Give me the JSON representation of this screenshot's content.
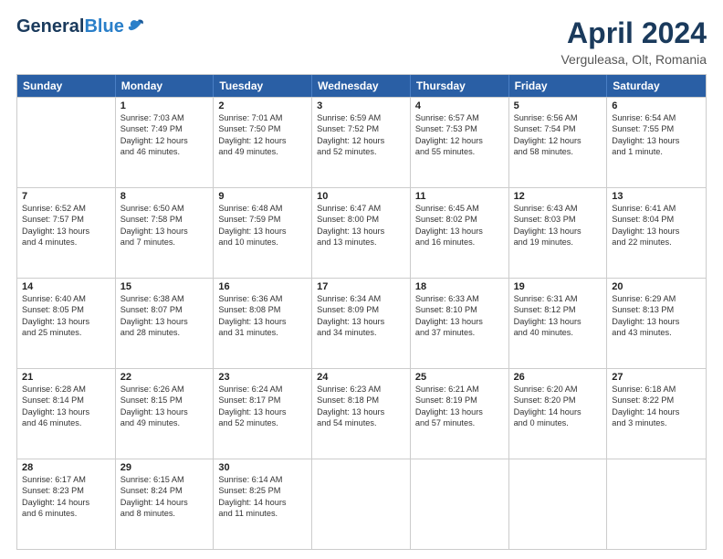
{
  "logo": {
    "general": "General",
    "blue": "Blue"
  },
  "title": "April 2024",
  "location": "Verguleasa, Olt, Romania",
  "headers": [
    "Sunday",
    "Monday",
    "Tuesday",
    "Wednesday",
    "Thursday",
    "Friday",
    "Saturday"
  ],
  "weeks": [
    [
      {
        "day": "",
        "info": ""
      },
      {
        "day": "1",
        "info": "Sunrise: 7:03 AM\nSunset: 7:49 PM\nDaylight: 12 hours\nand 46 minutes."
      },
      {
        "day": "2",
        "info": "Sunrise: 7:01 AM\nSunset: 7:50 PM\nDaylight: 12 hours\nand 49 minutes."
      },
      {
        "day": "3",
        "info": "Sunrise: 6:59 AM\nSunset: 7:52 PM\nDaylight: 12 hours\nand 52 minutes."
      },
      {
        "day": "4",
        "info": "Sunrise: 6:57 AM\nSunset: 7:53 PM\nDaylight: 12 hours\nand 55 minutes."
      },
      {
        "day": "5",
        "info": "Sunrise: 6:56 AM\nSunset: 7:54 PM\nDaylight: 12 hours\nand 58 minutes."
      },
      {
        "day": "6",
        "info": "Sunrise: 6:54 AM\nSunset: 7:55 PM\nDaylight: 13 hours\nand 1 minute."
      }
    ],
    [
      {
        "day": "7",
        "info": "Sunrise: 6:52 AM\nSunset: 7:57 PM\nDaylight: 13 hours\nand 4 minutes."
      },
      {
        "day": "8",
        "info": "Sunrise: 6:50 AM\nSunset: 7:58 PM\nDaylight: 13 hours\nand 7 minutes."
      },
      {
        "day": "9",
        "info": "Sunrise: 6:48 AM\nSunset: 7:59 PM\nDaylight: 13 hours\nand 10 minutes."
      },
      {
        "day": "10",
        "info": "Sunrise: 6:47 AM\nSunset: 8:00 PM\nDaylight: 13 hours\nand 13 minutes."
      },
      {
        "day": "11",
        "info": "Sunrise: 6:45 AM\nSunset: 8:02 PM\nDaylight: 13 hours\nand 16 minutes."
      },
      {
        "day": "12",
        "info": "Sunrise: 6:43 AM\nSunset: 8:03 PM\nDaylight: 13 hours\nand 19 minutes."
      },
      {
        "day": "13",
        "info": "Sunrise: 6:41 AM\nSunset: 8:04 PM\nDaylight: 13 hours\nand 22 minutes."
      }
    ],
    [
      {
        "day": "14",
        "info": "Sunrise: 6:40 AM\nSunset: 8:05 PM\nDaylight: 13 hours\nand 25 minutes."
      },
      {
        "day": "15",
        "info": "Sunrise: 6:38 AM\nSunset: 8:07 PM\nDaylight: 13 hours\nand 28 minutes."
      },
      {
        "day": "16",
        "info": "Sunrise: 6:36 AM\nSunset: 8:08 PM\nDaylight: 13 hours\nand 31 minutes."
      },
      {
        "day": "17",
        "info": "Sunrise: 6:34 AM\nSunset: 8:09 PM\nDaylight: 13 hours\nand 34 minutes."
      },
      {
        "day": "18",
        "info": "Sunrise: 6:33 AM\nSunset: 8:10 PM\nDaylight: 13 hours\nand 37 minutes."
      },
      {
        "day": "19",
        "info": "Sunrise: 6:31 AM\nSunset: 8:12 PM\nDaylight: 13 hours\nand 40 minutes."
      },
      {
        "day": "20",
        "info": "Sunrise: 6:29 AM\nSunset: 8:13 PM\nDaylight: 13 hours\nand 43 minutes."
      }
    ],
    [
      {
        "day": "21",
        "info": "Sunrise: 6:28 AM\nSunset: 8:14 PM\nDaylight: 13 hours\nand 46 minutes."
      },
      {
        "day": "22",
        "info": "Sunrise: 6:26 AM\nSunset: 8:15 PM\nDaylight: 13 hours\nand 49 minutes."
      },
      {
        "day": "23",
        "info": "Sunrise: 6:24 AM\nSunset: 8:17 PM\nDaylight: 13 hours\nand 52 minutes."
      },
      {
        "day": "24",
        "info": "Sunrise: 6:23 AM\nSunset: 8:18 PM\nDaylight: 13 hours\nand 54 minutes."
      },
      {
        "day": "25",
        "info": "Sunrise: 6:21 AM\nSunset: 8:19 PM\nDaylight: 13 hours\nand 57 minutes."
      },
      {
        "day": "26",
        "info": "Sunrise: 6:20 AM\nSunset: 8:20 PM\nDaylight: 14 hours\nand 0 minutes."
      },
      {
        "day": "27",
        "info": "Sunrise: 6:18 AM\nSunset: 8:22 PM\nDaylight: 14 hours\nand 3 minutes."
      }
    ],
    [
      {
        "day": "28",
        "info": "Sunrise: 6:17 AM\nSunset: 8:23 PM\nDaylight: 14 hours\nand 6 minutes."
      },
      {
        "day": "29",
        "info": "Sunrise: 6:15 AM\nSunset: 8:24 PM\nDaylight: 14 hours\nand 8 minutes."
      },
      {
        "day": "30",
        "info": "Sunrise: 6:14 AM\nSunset: 8:25 PM\nDaylight: 14 hours\nand 11 minutes."
      },
      {
        "day": "",
        "info": ""
      },
      {
        "day": "",
        "info": ""
      },
      {
        "day": "",
        "info": ""
      },
      {
        "day": "",
        "info": ""
      }
    ]
  ]
}
